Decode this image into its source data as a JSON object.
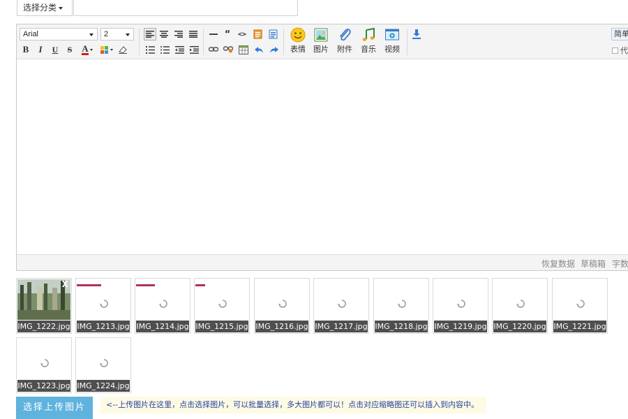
{
  "form": {
    "category_label": "选择分类",
    "title_value": ""
  },
  "toolbar": {
    "font_family": "Arial",
    "font_size": "2",
    "row1_buttons": [
      "align-left",
      "align-center",
      "align-right",
      "align-justify",
      "horizontal-rule",
      "blockquote",
      "code",
      "paste-word",
      "paste-text"
    ],
    "row2_buttons": [
      "bold",
      "italic",
      "underline",
      "strikethrough",
      "font-color",
      "highlight-color",
      "remove-format",
      "ordered-list",
      "unordered-list",
      "outdent",
      "indent",
      "link",
      "unlink",
      "table",
      "undo",
      "redo"
    ],
    "bold_glyph": "B",
    "italic_glyph": "I",
    "underline_glyph": "U",
    "strike_glyph": "S",
    "color_glyph": "A",
    "quote_glyph": "“",
    "code_glyph": "<>",
    "emoji_label": "表情",
    "image_label": "图片",
    "attach_label": "附件",
    "music_label": "音乐",
    "video_label": "视频",
    "mode_button": "简单",
    "code_checkbox": "代"
  },
  "status_bar": {
    "restore": "恢复数据",
    "draft": "草稿箱",
    "wordcount": "字数"
  },
  "thumbnails": [
    {
      "name": "IMG_1222.jpg",
      "state": "uploaded",
      "progress": 1.0
    },
    {
      "name": "IMG_1213.jpg",
      "state": "uploading",
      "progress": 0.45
    },
    {
      "name": "IMG_1214.jpg",
      "state": "uploading",
      "progress": 0.35
    },
    {
      "name": "IMG_1215.jpg",
      "state": "uploading",
      "progress": 0.18
    },
    {
      "name": "IMG_1216.jpg",
      "state": "queued",
      "progress": 0
    },
    {
      "name": "IMG_1217.jpg",
      "state": "queued",
      "progress": 0
    },
    {
      "name": "IMG_1218.jpg",
      "state": "queued",
      "progress": 0
    },
    {
      "name": "IMG_1219.jpg",
      "state": "queued",
      "progress": 0
    },
    {
      "name": "IMG_1220.jpg",
      "state": "queued",
      "progress": 0
    },
    {
      "name": "IMG_1221.jpg",
      "state": "queued",
      "progress": 0
    },
    {
      "name": "IMG_1223.jpg",
      "state": "queued",
      "progress": 0
    },
    {
      "name": "IMG_1224.jpg",
      "state": "queued",
      "progress": 0
    }
  ],
  "thumb_close_glyph": "X",
  "upload": {
    "button_label": "选择上传图片",
    "tip": "<--上传图片在这里，点击选择图片，可以批量选择，多大图片都可以！点击对应缩略图还可以插入到内容中。"
  },
  "colors": {
    "accent_button": "#5fb3dd",
    "progress_bar": "#b03060",
    "filename_bg": "#4f4f4f",
    "tip_bg": "#fdfbe4",
    "tip_text": "#2a40a0"
  }
}
